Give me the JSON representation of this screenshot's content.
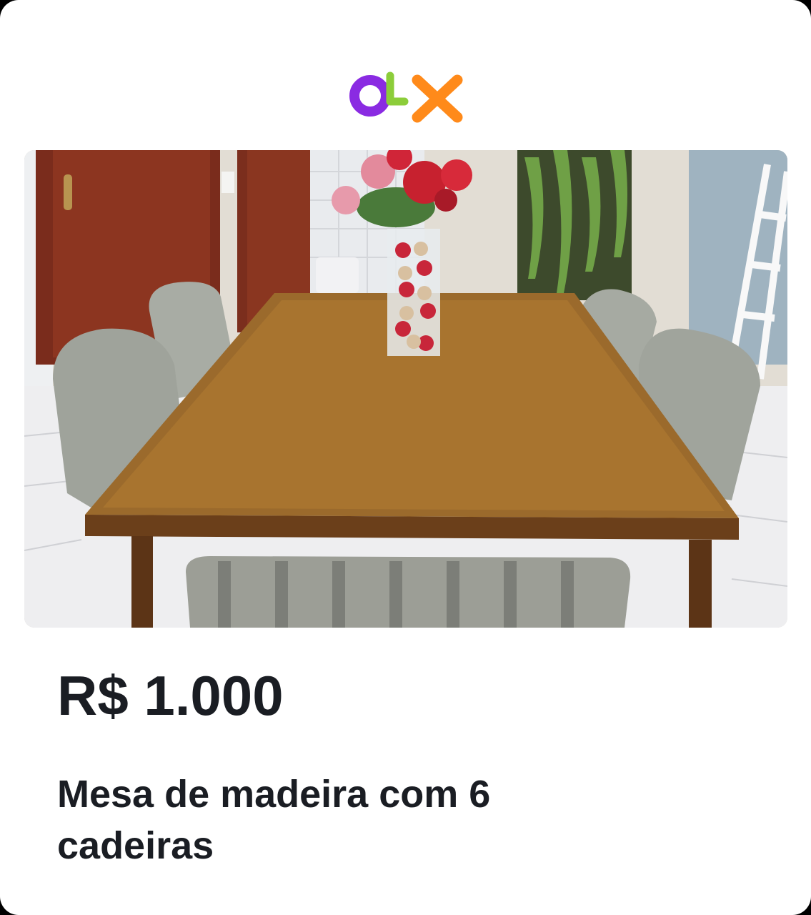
{
  "listing": {
    "brand": "OLX",
    "price": "R$ 1.000",
    "title": "Mesa de madeira com 6 cadeiras",
    "photo_subject": "dining-table-with-chairs"
  },
  "colors": {
    "background": "#ffffff",
    "text": "#1a1d23",
    "logo_o": "#8a2be2",
    "logo_l": "#8ccd3a",
    "logo_x": "#ff8a1a"
  }
}
